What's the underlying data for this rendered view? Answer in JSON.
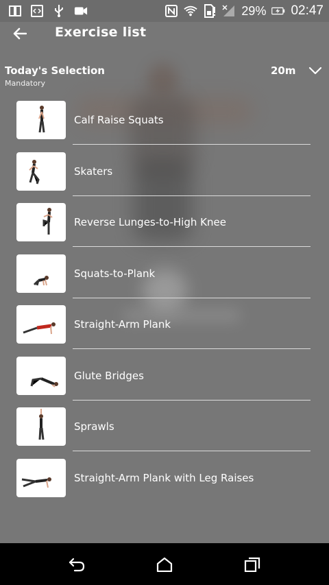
{
  "status_bar": {
    "battery_percent": "29%",
    "time": "02:47",
    "icons": [
      "screen-mirror-icon",
      "code-icon",
      "usb-icon",
      "video-icon",
      "nfc-icon",
      "wifi-icon",
      "sd-alert-icon",
      "signal-icon",
      "battery-charging-icon"
    ]
  },
  "header": {
    "title": "Exercise list",
    "back_icon": "back-arrow-icon"
  },
  "selection": {
    "title": "Today's Selection",
    "subtitle": "Mandatory",
    "duration": "20m",
    "chevron_icon": "chevron-down-icon"
  },
  "exercises": [
    {
      "name": "Calf Raise Squats"
    },
    {
      "name": "Skaters"
    },
    {
      "name": "Reverse Lunges-to-High Knee"
    },
    {
      "name": "Squats-to-Plank"
    },
    {
      "name": "Straight-Arm Plank"
    },
    {
      "name": "Glute Bridges"
    },
    {
      "name": "Sprawls"
    },
    {
      "name": "Straight-Arm Plank with Leg Raises"
    }
  ],
  "nav_bar": {
    "icons": [
      "nav-back-icon",
      "nav-home-icon",
      "nav-recent-apps-icon"
    ]
  },
  "colors": {
    "background": "#777777",
    "status_bar": "#6c6c6c",
    "nav_bar": "#000000",
    "text": "#ffffff",
    "divider": "#dcdcdc"
  }
}
